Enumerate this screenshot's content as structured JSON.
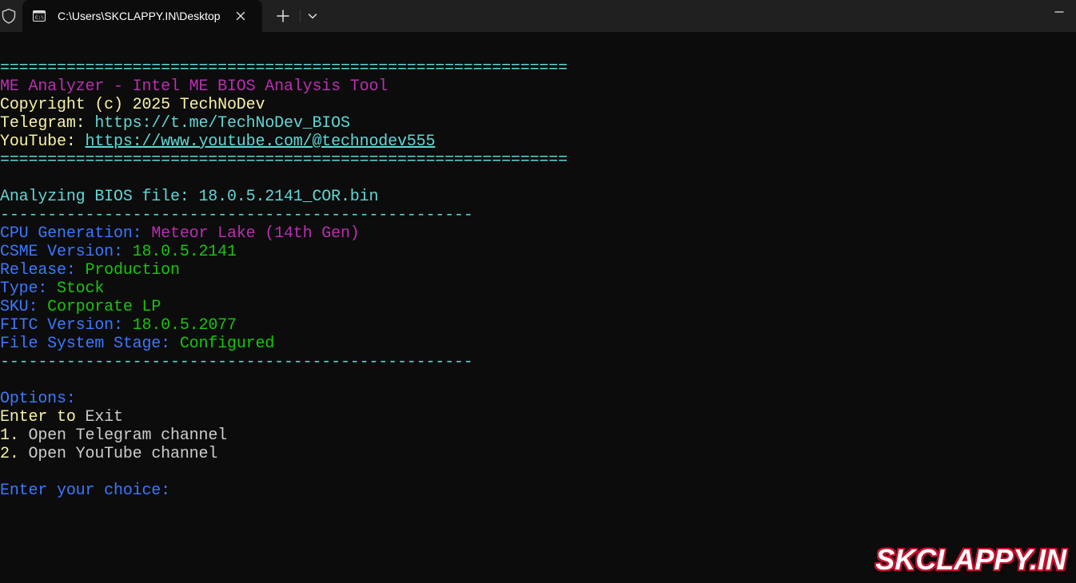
{
  "window": {
    "tab_title": "C:\\Users\\SKCLAPPY.IN\\Desktop",
    "icons": {
      "shield": "shield-icon",
      "tab": "terminal-icon",
      "close": "close-icon",
      "new_tab": "plus-icon",
      "dropdown": "chevron-down-icon",
      "minimize": "minimize-icon"
    }
  },
  "terminal": {
    "colors": {
      "background": "#0c0c0c",
      "cyan": "#61d6d6",
      "yellow": "#f9f1a5",
      "magenta": "#b92fb0",
      "blue": "#3b78ff",
      "green": "#16c60c",
      "white": "#cccccc"
    },
    "rule_double": "============================================================",
    "header": {
      "title": "ME Analyzer - Intel ME BIOS Analysis Tool",
      "copyright": "Copyright (c) 2025 TechNoDev",
      "telegram_label": "Telegram:",
      "telegram_url": "https://t.me/TechNoDev_BIOS",
      "youtube_label": "YouTube:",
      "youtube_url": "https://www.youtube.com/@technodev555"
    },
    "analyzing": "Analyzing BIOS file: 18.0.5.2141_COR.bin",
    "rule_single": "--------------------------------------------------",
    "info": [
      {
        "label": "CPU Generation:",
        "value": "Meteor Lake (14th Gen)",
        "value_color": "magenta"
      },
      {
        "label": "CSME Version:",
        "value": "18.0.5.2141",
        "value_color": "green"
      },
      {
        "label": "Release:",
        "value": "Production",
        "value_color": "green"
      },
      {
        "label": "Type:",
        "value": "Stock",
        "value_color": "green"
      },
      {
        "label": "SKU:",
        "value": "Corporate LP",
        "value_color": "green"
      },
      {
        "label": "FITC Version:",
        "value": "18.0.5.2077",
        "value_color": "green"
      },
      {
        "label": "File System Stage:",
        "value": "Configured",
        "value_color": "green"
      }
    ],
    "options": {
      "heading": "Options:",
      "enter_key": "Enter to",
      "enter_action": "Exit",
      "items": [
        {
          "key": "1.",
          "label": "Open Telegram channel"
        },
        {
          "key": "2.",
          "label": "Open YouTube channel"
        }
      ],
      "prompt": "Enter your choice:"
    }
  },
  "watermark": "SKCLAPPY.IN"
}
